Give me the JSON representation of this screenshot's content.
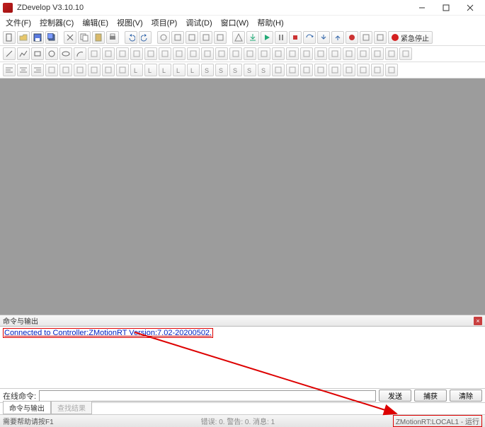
{
  "window": {
    "title": "ZDevelop V3.10.10"
  },
  "menu": {
    "file": "文件(F)",
    "controller": "控制器(C)",
    "edit": "编辑(E)",
    "view": "视图(V)",
    "project": "项目(P)",
    "debug": "调试(D)",
    "window": "窗口(W)",
    "help": "帮助(H)"
  },
  "toolbar": {
    "estop_label": "紧急停止"
  },
  "output": {
    "panel_title": "命令与输出",
    "message": "Connected to Controller:ZMotionRT Version:7.02-20200502."
  },
  "command": {
    "label": "在线命令:",
    "value": "",
    "send": "发送",
    "capture": "捕获",
    "clear": "清除"
  },
  "tabs": {
    "cmd_output": "命令与输出",
    "find_results": "查找结果"
  },
  "status": {
    "help_hint": "需要帮助请按F1",
    "errors": "错误: 0. 警告: 0. 消息: 1",
    "connection": "ZMotionRT:LOCAL1 - 运行"
  }
}
